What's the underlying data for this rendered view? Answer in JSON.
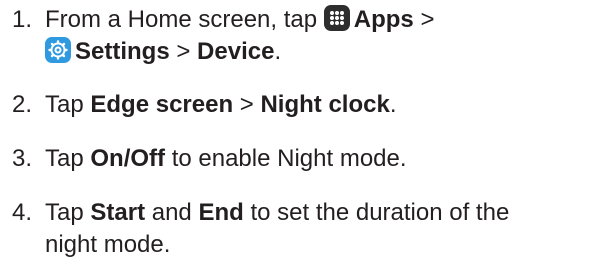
{
  "steps": [
    {
      "number": "1.",
      "prefix": "From a Home screen, tap",
      "apps_icon": "apps-grid-icon",
      "apps": "Apps",
      "sep1": ">",
      "settings_icon": "settings-gear-icon",
      "settings": "Settings",
      "sep2": ">",
      "device": "Device",
      "end": "."
    },
    {
      "number": "2.",
      "prefix": "Tap",
      "edge": "Edge screen",
      "sep": ">",
      "night_clock": "Night clock",
      "end": "."
    },
    {
      "number": "3.",
      "prefix": "Tap",
      "onoff": "On/Off",
      "suffix": "to enable Night mode."
    },
    {
      "number": "4.",
      "prefix": "Tap",
      "start": "Start",
      "and": "and",
      "end_word": "End",
      "suffix_line1": "to set the duration of the",
      "suffix_line2": "night mode."
    }
  ],
  "colors": {
    "text": "#231f20",
    "apps_icon": "#2e2e2e",
    "settings_icon": "#2f9ae0"
  }
}
